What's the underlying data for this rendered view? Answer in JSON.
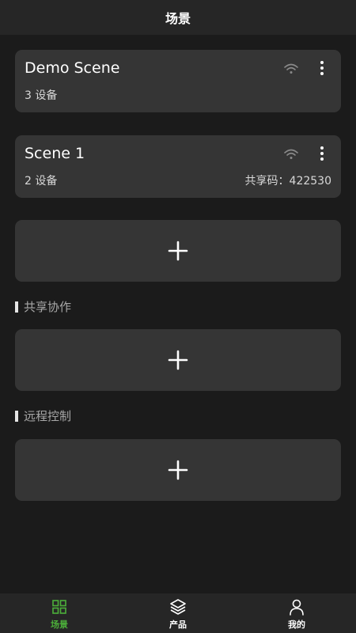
{
  "header": {
    "title": "场景"
  },
  "scenes": [
    {
      "name": "Demo Scene",
      "devices": "3 设备",
      "share_label": "",
      "share_code": ""
    },
    {
      "name": "Scene 1",
      "devices": "2 设备",
      "share_label": "共享码：",
      "share_code": "422530"
    }
  ],
  "sections": {
    "shared": {
      "title": "共享协作"
    },
    "remote": {
      "title": "远程控制"
    }
  },
  "tabs": [
    {
      "label": "场景",
      "icon": "grid-icon",
      "active": true
    },
    {
      "label": "产品",
      "icon": "layers-icon",
      "active": false
    },
    {
      "label": "我的",
      "icon": "person-icon",
      "active": false
    }
  ],
  "colors": {
    "background": "#1b1b1b",
    "card": "#353535",
    "bar": "#262626",
    "accent": "#4caf3a"
  }
}
